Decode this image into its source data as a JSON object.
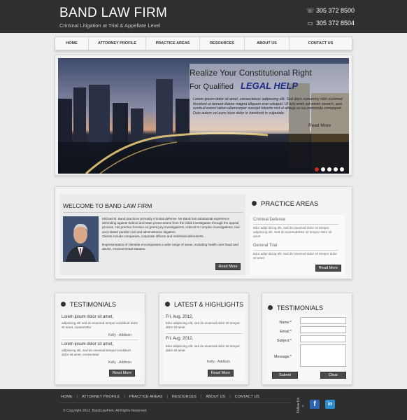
{
  "header": {
    "logo": "BAND LAW FIRM",
    "tagline": "Criminal Litigation at Trial & Appellate Level",
    "phone1": "305 372 8500",
    "phone2": "305 372 8504"
  },
  "nav": {
    "items": [
      {
        "label": "HOME"
      },
      {
        "label": "ATTORNEY PROFILE"
      },
      {
        "label": "PRACTICE AREAS"
      },
      {
        "label": "RESOURCES"
      },
      {
        "label": "ABOUT US"
      },
      {
        "label": "CONTACT US"
      }
    ]
  },
  "slider": {
    "headline": "Realize Your Constitutional Right",
    "subline": "For Qualified",
    "highlight": "LEGAL HELP",
    "body": "Lorem ipsum dolor sit amet, consectetuer adipiscing elit. Sed diam nonummy nibh euismod tincidunt ut laoreet dolore magna aliquam erat volutpat. Ut wisi enim ad minim veniam, quis nostrud exerci tation ullamcorper suscipit lobortis nisl ut aliquip ex ea commodo consequat. Duis autem vel eum iriure dolor in hendrerit in vulputate.",
    "more": "Read More",
    "active_slide": 1,
    "slide_count": 5
  },
  "welcome": {
    "title": "WELCOME TO BAND LAW FIRM",
    "para1": "Michael B. Band practices primarily criminal defense. Mr Band has substantial experience defending against federal and state prosecutions from the initial investigation through the appeal process. His practice focuses on grand jury investigations, referral to complex investigations, trial and related parallel civil and administrative litigation.",
    "para2": "Clients include companies, corporate officers and individual defendants.",
    "para3": "Representation of clientele encompasses a wide range of areas, including health care fraud and abuse, environmental statutes.",
    "button": "Read More"
  },
  "practice": {
    "title": "PRACTICE AREAS",
    "items": [
      {
        "head": "Criminal Defense",
        "text": "Itdur adipi dicing elit, sed do eiusmod dolor sit tempor adipiscing elit. Sed do eiusmoddolor sit tempor dolor sit amet"
      },
      {
        "head": "General Trial",
        "text": "Itdur adipi dicing elit, sed do eiusmod dolor sit tempor dolor sit amet"
      }
    ],
    "button": "Read More"
  },
  "testimonials": {
    "title": "TESTIMONIALS",
    "items": [
      {
        "head": "Lorem ipsum dolor sit amet,",
        "text": "adipiscing elit sed do eiusmod tempor incididunt dolor sit amet, consectetur",
        "sig": "Kelly - Addison"
      },
      {
        "head": "Lorem ipsum dolor sit amet,",
        "text": "adipiscing elit, sed do eiusmod tempor incididunt dolor sit amet, consectetur",
        "sig": "Kelly - Addison"
      }
    ],
    "button": "Read More"
  },
  "latest": {
    "title": "LATEST & HIGHLIGHTS",
    "items": [
      {
        "date": "Fri, Aug. 2012,",
        "text": "Itdur adipiscing elit, sed do eiusmod dolor sit tempor dolor sit amet"
      },
      {
        "date": "Fri, Aug. 2012,",
        "text": "Itdur adipiscing elit, sed do eiusmod dolor sit tempor dolor sit amet"
      }
    ],
    "sig": "Kelly - Addison",
    "button": "Read More"
  },
  "contact_form": {
    "title": "TESTIMONIALS",
    "name_label": "Name:*",
    "email_label": "Email:*",
    "subject_label": "Subject:*",
    "message_label": "Message:*",
    "submit": "Submit",
    "clear": "Clear"
  },
  "footer": {
    "links": [
      {
        "label": "HOME"
      },
      {
        "label": "ATTORNEY PROFILE"
      },
      {
        "label": "PRACTICE AREAS"
      },
      {
        "label": "RESOURCES"
      },
      {
        "label": "ABOUT US"
      },
      {
        "label": "CONTACT US"
      }
    ],
    "separator": "|",
    "copyright": "© Copyright 2012. BandLawFirm. All Rights Reserved.",
    "follow_label": "Follow Us",
    "facebook": "f",
    "linkedin": "in"
  },
  "colors": {
    "header_bg": "#2f2f2f",
    "accent_blue": "#1c2c84",
    "active_dot": "#c0312b",
    "facebook": "#2f64b4",
    "linkedin": "#2a8ed0"
  }
}
